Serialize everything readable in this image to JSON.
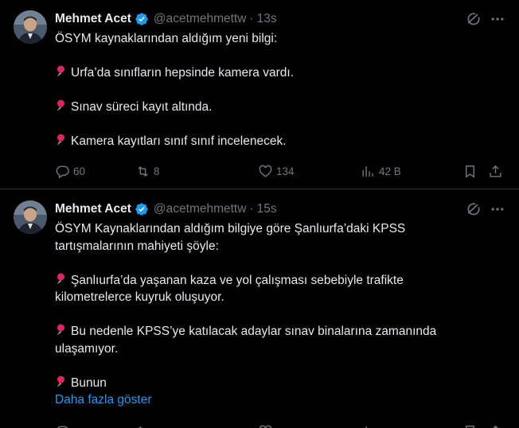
{
  "tweets": [
    {
      "author": {
        "name": "Mehmet Acet",
        "handle": "@acetmehmettw",
        "time": "13s"
      },
      "lines": [
        "ÖSYM kaynaklarından aldığım yeni bilgi:",
        "",
        "Urfa’da sınıfların hepsinde kamera vardı.",
        "",
        "Sınav süreci kayıt altında.",
        "",
        "Kamera kayıtları sınıf sınıf incelenecek."
      ],
      "pinned_lines": [
        2,
        4,
        6
      ],
      "stats": {
        "replies": "60",
        "retweets": "8",
        "likes": "134",
        "views": "42 B"
      }
    },
    {
      "author": {
        "name": "Mehmet Acet",
        "handle": "@acetmehmettw",
        "time": "15s"
      },
      "lines": [
        "ÖSYM Kaynaklarından aldığım bilgiye göre Şanlıurfa’daki KPSS",
        "tartışmalarının mahiyeti şöyle:",
        "",
        "Şanlıurfa’da yaşanan kaza ve yol çalışması sebebiyle trafikte",
        "kilometrelerce kuyruk oluşuyor.",
        "",
        "Bu nedenle KPSS’ye katılacak adaylar sınav binalarına zamanında",
        "ulaşamıyor.",
        "",
        "Bunun"
      ],
      "pinned_lines": [
        3,
        6,
        9
      ],
      "show_more": "Daha fazla göster"
    }
  ],
  "icons": {
    "verified": "verified-badge-icon",
    "grok": "grok-icon",
    "more": "more-icon",
    "pin": "pushpin-icon",
    "reply": "reply-icon",
    "retweet": "retweet-icon",
    "like": "heart-icon",
    "views": "views-icon",
    "bookmark": "bookmark-icon",
    "share": "share-icon"
  },
  "colors": {
    "background": "#000000",
    "text": "#e7e9ea",
    "muted": "#71767b",
    "accent": "#1d9bf0",
    "divider": "#2f3336",
    "pin": "#e0245e"
  }
}
